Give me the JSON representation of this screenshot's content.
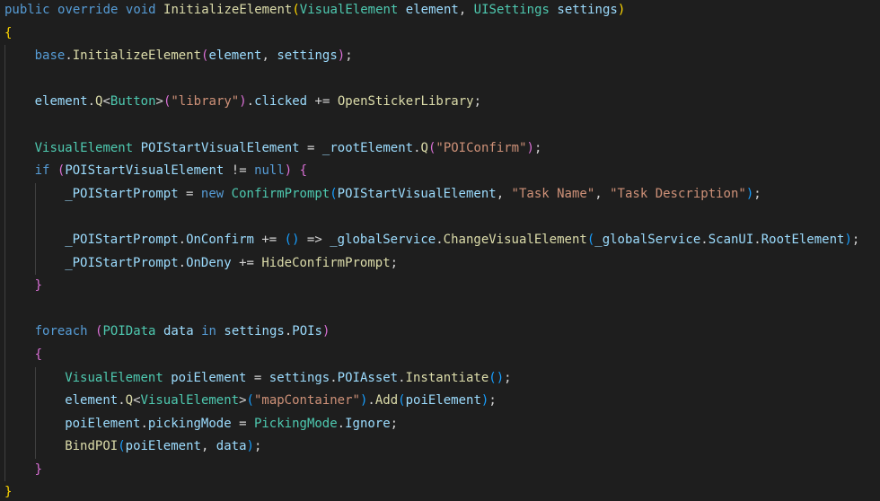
{
  "colors": {
    "background": "#1e1e1e",
    "default": "#d4d4d4",
    "kw": "#569cd6",
    "fn": "#dcdcaa",
    "type": "#4ec9b0",
    "var": "#9cdcfe",
    "str": "#ce9178",
    "op": "#d4d4d4",
    "brk1": "#ffd700",
    "brk2": "#da70d6",
    "brk3": "#179fff",
    "guide": "#404040"
  },
  "code": {
    "lines": [
      {
        "indent": 0,
        "tokens": [
          {
            "t": "public",
            "c": "kw"
          },
          {
            "t": " ",
            "c": "op"
          },
          {
            "t": "override",
            "c": "kw"
          },
          {
            "t": " ",
            "c": "op"
          },
          {
            "t": "void",
            "c": "kw"
          },
          {
            "t": " ",
            "c": "op"
          },
          {
            "t": "InitializeElement",
            "c": "fn"
          },
          {
            "t": "(",
            "c": "brk1"
          },
          {
            "t": "VisualElement",
            "c": "type"
          },
          {
            "t": " ",
            "c": "op"
          },
          {
            "t": "element",
            "c": "var"
          },
          {
            "t": ", ",
            "c": "op"
          },
          {
            "t": "UISettings",
            "c": "type"
          },
          {
            "t": " ",
            "c": "op"
          },
          {
            "t": "settings",
            "c": "var"
          },
          {
            "t": ")",
            "c": "brk1"
          }
        ]
      },
      {
        "indent": 0,
        "tokens": [
          {
            "t": "{",
            "c": "brk1"
          }
        ]
      },
      {
        "indent": 1,
        "tokens": [
          {
            "t": "base",
            "c": "kw"
          },
          {
            "t": ".",
            "c": "op"
          },
          {
            "t": "InitializeElement",
            "c": "fn"
          },
          {
            "t": "(",
            "c": "brk2"
          },
          {
            "t": "element",
            "c": "var"
          },
          {
            "t": ", ",
            "c": "op"
          },
          {
            "t": "settings",
            "c": "var"
          },
          {
            "t": ")",
            "c": "brk2"
          },
          {
            "t": ";",
            "c": "op"
          }
        ]
      },
      {
        "indent": 1,
        "tokens": []
      },
      {
        "indent": 1,
        "tokens": [
          {
            "t": "element",
            "c": "var"
          },
          {
            "t": ".",
            "c": "op"
          },
          {
            "t": "Q",
            "c": "fn"
          },
          {
            "t": "<",
            "c": "op"
          },
          {
            "t": "Button",
            "c": "type"
          },
          {
            "t": ">",
            "c": "op"
          },
          {
            "t": "(",
            "c": "brk2"
          },
          {
            "t": "\"library\"",
            "c": "str"
          },
          {
            "t": ")",
            "c": "brk2"
          },
          {
            "t": ".",
            "c": "op"
          },
          {
            "t": "clicked",
            "c": "var"
          },
          {
            "t": " += ",
            "c": "op"
          },
          {
            "t": "OpenStickerLibrary",
            "c": "fn"
          },
          {
            "t": ";",
            "c": "op"
          }
        ]
      },
      {
        "indent": 1,
        "tokens": []
      },
      {
        "indent": 1,
        "tokens": [
          {
            "t": "VisualElement",
            "c": "type"
          },
          {
            "t": " ",
            "c": "op"
          },
          {
            "t": "POIStartVisualElement",
            "c": "var"
          },
          {
            "t": " = ",
            "c": "op"
          },
          {
            "t": "_rootElement",
            "c": "var"
          },
          {
            "t": ".",
            "c": "op"
          },
          {
            "t": "Q",
            "c": "fn"
          },
          {
            "t": "(",
            "c": "brk2"
          },
          {
            "t": "\"POIConfirm\"",
            "c": "str"
          },
          {
            "t": ")",
            "c": "brk2"
          },
          {
            "t": ";",
            "c": "op"
          }
        ]
      },
      {
        "indent": 1,
        "tokens": [
          {
            "t": "if",
            "c": "kw"
          },
          {
            "t": " ",
            "c": "op"
          },
          {
            "t": "(",
            "c": "brk2"
          },
          {
            "t": "POIStartVisualElement",
            "c": "var"
          },
          {
            "t": " != ",
            "c": "op"
          },
          {
            "t": "null",
            "c": "kw"
          },
          {
            "t": ")",
            "c": "brk2"
          },
          {
            "t": " ",
            "c": "op"
          },
          {
            "t": "{",
            "c": "brk2"
          }
        ]
      },
      {
        "indent": 2,
        "tokens": [
          {
            "t": "_POIStartPrompt",
            "c": "var"
          },
          {
            "t": " = ",
            "c": "op"
          },
          {
            "t": "new",
            "c": "kw"
          },
          {
            "t": " ",
            "c": "op"
          },
          {
            "t": "ConfirmPrompt",
            "c": "type"
          },
          {
            "t": "(",
            "c": "brk3"
          },
          {
            "t": "POIStartVisualElement",
            "c": "var"
          },
          {
            "t": ", ",
            "c": "op"
          },
          {
            "t": "\"Task Name\"",
            "c": "str"
          },
          {
            "t": ", ",
            "c": "op"
          },
          {
            "t": "\"Task Description\"",
            "c": "str"
          },
          {
            "t": ")",
            "c": "brk3"
          },
          {
            "t": ";",
            "c": "op"
          }
        ]
      },
      {
        "indent": 2,
        "tokens": []
      },
      {
        "indent": 2,
        "tokens": [
          {
            "t": "_POIStartPrompt",
            "c": "var"
          },
          {
            "t": ".",
            "c": "op"
          },
          {
            "t": "OnConfirm",
            "c": "var"
          },
          {
            "t": " += ",
            "c": "op"
          },
          {
            "t": "()",
            "c": "brk3"
          },
          {
            "t": " => ",
            "c": "op"
          },
          {
            "t": "_globalService",
            "c": "var"
          },
          {
            "t": ".",
            "c": "op"
          },
          {
            "t": "ChangeVisualElement",
            "c": "fn"
          },
          {
            "t": "(",
            "c": "brk3"
          },
          {
            "t": "_globalService",
            "c": "var"
          },
          {
            "t": ".",
            "c": "op"
          },
          {
            "t": "ScanUI",
            "c": "var"
          },
          {
            "t": ".",
            "c": "op"
          },
          {
            "t": "RootElement",
            "c": "var"
          },
          {
            "t": ")",
            "c": "brk3"
          },
          {
            "t": ";",
            "c": "op"
          }
        ]
      },
      {
        "indent": 2,
        "tokens": [
          {
            "t": "_POIStartPrompt",
            "c": "var"
          },
          {
            "t": ".",
            "c": "op"
          },
          {
            "t": "OnDeny",
            "c": "var"
          },
          {
            "t": " += ",
            "c": "op"
          },
          {
            "t": "HideConfirmPrompt",
            "c": "fn"
          },
          {
            "t": ";",
            "c": "op"
          }
        ]
      },
      {
        "indent": 1,
        "tokens": [
          {
            "t": "}",
            "c": "brk2"
          }
        ]
      },
      {
        "indent": 1,
        "tokens": []
      },
      {
        "indent": 1,
        "tokens": [
          {
            "t": "foreach",
            "c": "kw"
          },
          {
            "t": " ",
            "c": "op"
          },
          {
            "t": "(",
            "c": "brk2"
          },
          {
            "t": "POIData",
            "c": "type"
          },
          {
            "t": " ",
            "c": "op"
          },
          {
            "t": "data",
            "c": "var"
          },
          {
            "t": " ",
            "c": "op"
          },
          {
            "t": "in",
            "c": "kw"
          },
          {
            "t": " ",
            "c": "op"
          },
          {
            "t": "settings",
            "c": "var"
          },
          {
            "t": ".",
            "c": "op"
          },
          {
            "t": "POIs",
            "c": "var"
          },
          {
            "t": ")",
            "c": "brk2"
          }
        ]
      },
      {
        "indent": 1,
        "tokens": [
          {
            "t": "{",
            "c": "brk2"
          }
        ]
      },
      {
        "indent": 2,
        "tokens": [
          {
            "t": "VisualElement",
            "c": "type"
          },
          {
            "t": " ",
            "c": "op"
          },
          {
            "t": "poiElement",
            "c": "var"
          },
          {
            "t": " = ",
            "c": "op"
          },
          {
            "t": "settings",
            "c": "var"
          },
          {
            "t": ".",
            "c": "op"
          },
          {
            "t": "POIAsset",
            "c": "var"
          },
          {
            "t": ".",
            "c": "op"
          },
          {
            "t": "Instantiate",
            "c": "fn"
          },
          {
            "t": "()",
            "c": "brk3"
          },
          {
            "t": ";",
            "c": "op"
          }
        ]
      },
      {
        "indent": 2,
        "tokens": [
          {
            "t": "element",
            "c": "var"
          },
          {
            "t": ".",
            "c": "op"
          },
          {
            "t": "Q",
            "c": "fn"
          },
          {
            "t": "<",
            "c": "op"
          },
          {
            "t": "VisualElement",
            "c": "type"
          },
          {
            "t": ">",
            "c": "op"
          },
          {
            "t": "(",
            "c": "brk3"
          },
          {
            "t": "\"mapContainer\"",
            "c": "str"
          },
          {
            "t": ")",
            "c": "brk3"
          },
          {
            "t": ".",
            "c": "op"
          },
          {
            "t": "Add",
            "c": "fn"
          },
          {
            "t": "(",
            "c": "brk3"
          },
          {
            "t": "poiElement",
            "c": "var"
          },
          {
            "t": ")",
            "c": "brk3"
          },
          {
            "t": ";",
            "c": "op"
          }
        ]
      },
      {
        "indent": 2,
        "tokens": [
          {
            "t": "poiElement",
            "c": "var"
          },
          {
            "t": ".",
            "c": "op"
          },
          {
            "t": "pickingMode",
            "c": "var"
          },
          {
            "t": " = ",
            "c": "op"
          },
          {
            "t": "PickingMode",
            "c": "type"
          },
          {
            "t": ".",
            "c": "op"
          },
          {
            "t": "Ignore",
            "c": "var"
          },
          {
            "t": ";",
            "c": "op"
          }
        ]
      },
      {
        "indent": 2,
        "tokens": [
          {
            "t": "BindPOI",
            "c": "fn"
          },
          {
            "t": "(",
            "c": "brk3"
          },
          {
            "t": "poiElement",
            "c": "var"
          },
          {
            "t": ", ",
            "c": "op"
          },
          {
            "t": "data",
            "c": "var"
          },
          {
            "t": ")",
            "c": "brk3"
          },
          {
            "t": ";",
            "c": "op"
          }
        ]
      },
      {
        "indent": 1,
        "tokens": [
          {
            "t": "}",
            "c": "brk2"
          }
        ]
      },
      {
        "indent": 0,
        "tokens": [
          {
            "t": "}",
            "c": "brk1"
          }
        ]
      }
    ]
  }
}
